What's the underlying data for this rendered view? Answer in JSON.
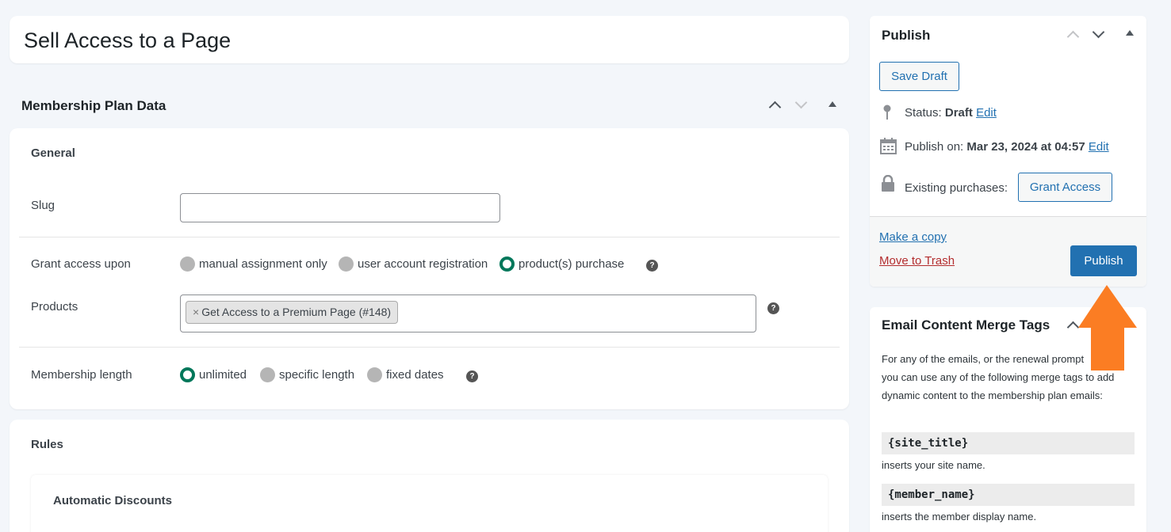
{
  "page_title": "Sell Access to a Page",
  "membership_plan": {
    "heading": "Membership Plan Data",
    "general": {
      "heading": "General",
      "slug_label": "Slug",
      "slug_value": "",
      "grant_label": "Grant access upon",
      "grant_options": [
        "manual assignment only",
        "user account registration",
        "product(s) purchase"
      ],
      "grant_selected": "product(s) purchase",
      "products_label": "Products",
      "products_tag_remove": "×",
      "products_tag": "Get Access to a Premium Page (#148)",
      "length_label": "Membership length",
      "length_options": [
        "unlimited",
        "specific length",
        "fixed dates"
      ],
      "length_selected": "unlimited",
      "help_glyph": "?"
    },
    "rules": {
      "heading": "Rules",
      "automatic_discounts": "Automatic Discounts"
    }
  },
  "publish_box": {
    "heading": "Publish",
    "save_draft": "Save Draft",
    "status_label": "Status:",
    "status_value": "Draft",
    "status_edit": "Edit",
    "publish_on_label": "Publish on:",
    "publish_on_value": "Mar 23, 2024 at 04:57",
    "publish_on_edit": "Edit",
    "existing_label": "Existing purchases:",
    "grant_access": "Grant Access",
    "make_copy": "Make a copy",
    "move_trash": "Move to Trash",
    "publish_button": "Publish"
  },
  "merge_tags": {
    "heading": "Email Content Merge Tags",
    "description": "For any of the emails, or the renewal prompt          nt, you can use any of the following merge tags to add dynamic content to the membership plan emails:",
    "tags": [
      {
        "tag": "{site_title}",
        "desc": "inserts your site name."
      },
      {
        "tag": "{member_name}",
        "desc": "inserts the member display name."
      }
    ]
  },
  "colors": {
    "accent": "#2271b1",
    "radio_selected": "#00775a",
    "trash": "#b32d2e",
    "arrow": "#fb7d23"
  }
}
